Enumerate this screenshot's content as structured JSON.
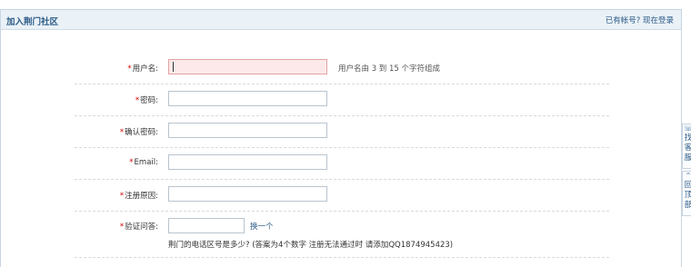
{
  "header": {
    "title": "加入荆门社区",
    "login_link": "已有帐号? 现在登录"
  },
  "form": {
    "username": {
      "required_mark": "*",
      "label": "用户名:",
      "value": "",
      "hint": "用户名由 3 到 15 个字符组成"
    },
    "password": {
      "required_mark": "*",
      "label": "密码:",
      "value": ""
    },
    "confirm_password": {
      "required_mark": "*",
      "label": "确认密码:",
      "value": ""
    },
    "email": {
      "required_mark": "*",
      "label": "Email:",
      "value": ""
    },
    "reason": {
      "required_mark": "*",
      "label": "注册原因:",
      "value": ""
    },
    "verification": {
      "required_mark": "*",
      "label": "验证问答:",
      "value": "",
      "swap_link": "换一个",
      "question": "荆门的电话区号是多少? (答案为4个数字 注册无法通过时 请添加QQ1874945423)"
    }
  },
  "side_tabs": [
    {
      "icon": "headset-icon",
      "text_lines": [
        "找",
        "客",
        "服"
      ]
    },
    {
      "icon": "back-to-top-icon",
      "text_lines": [
        "回",
        "顶",
        "部"
      ]
    }
  ]
}
